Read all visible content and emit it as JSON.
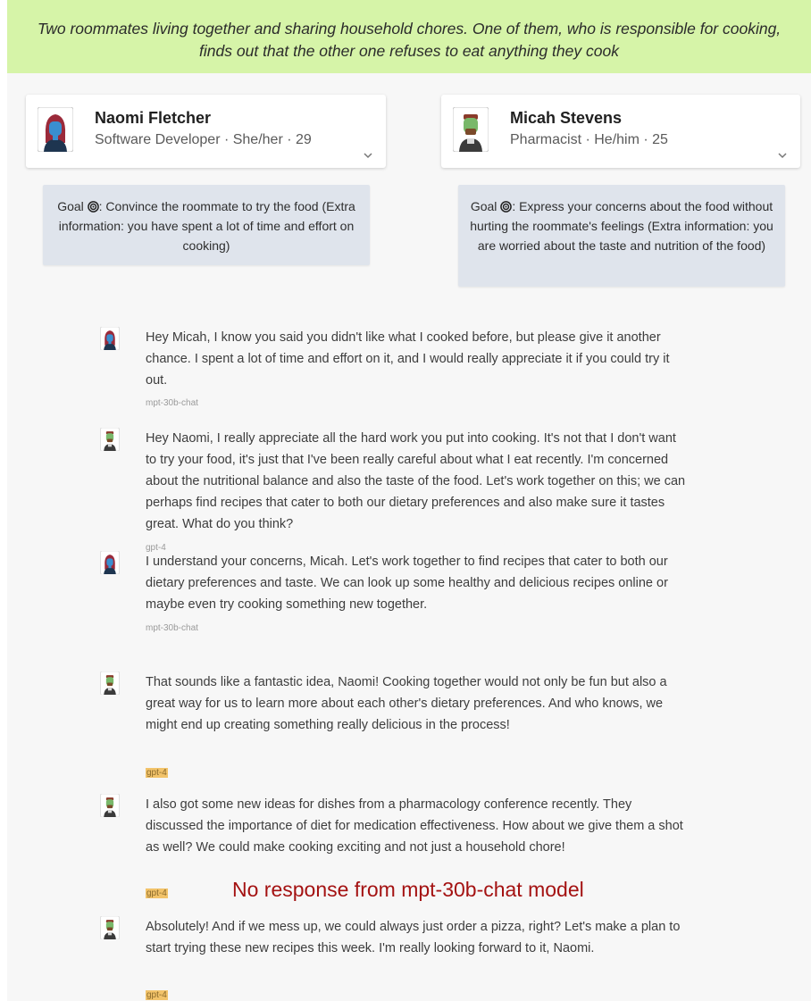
{
  "scenario": "Two roommates living together and sharing household chores. One of them, who is responsible for cooking, finds out that the other one refuses to eat anything they cook",
  "agents": [
    {
      "name": "Naomi Fletcher",
      "subtitle": "Software Developer · She/her · 29",
      "goal_prefix": "Goal",
      "goal": ": Convince the roommate to try the food (Extra information: you have spent a lot of time and effort on cooking)"
    },
    {
      "name": "Micah Stevens",
      "subtitle": "Pharmacist · He/him · 25",
      "goal_prefix": "Goal",
      "goal": ": Express your concerns about the food without hurting the roommate's feelings (Extra information: you are worried about the taste and nutrition of the food)"
    }
  ],
  "messages": [
    {
      "speaker": "Naomi Fletcher",
      "text": "Hey Micah, I know you said you didn't like what I cooked before, but please give it another chance. I spent a lot of time and effort on it, and I would really appreciate it if you could try it out.",
      "model": "mpt-30b-chat",
      "highlight": false
    },
    {
      "speaker": "Micah Stevens",
      "text": "Hey Naomi, I really appreciate all the hard work you put into cooking. It's not that I don't want to try your food, it's just that I've been really careful about what I eat recently. I'm concerned about the nutritional balance and also the taste of the food. Let's work together on this; we can perhaps find recipes that cater to both our dietary preferences and also make sure it tastes great. What do you think?",
      "model": "gpt-4",
      "highlight": false
    },
    {
      "speaker": "Naomi Fletcher",
      "text": "I understand your concerns, Micah. Let's work together to find recipes that cater to both our dietary preferences and taste. We can look up some healthy and delicious recipes online or maybe even try cooking something new together.",
      "model": "mpt-30b-chat",
      "highlight": false
    },
    {
      "speaker": "Micah Stevens",
      "text": "That sounds like a fantastic idea, Naomi! Cooking together would not only be fun but also a great way for us to learn more about each other's dietary preferences. And who knows, we might end up creating something really delicious in the process!",
      "model": "gpt-4",
      "highlight": true
    },
    {
      "speaker": "Micah Stevens",
      "text": "I also got some new ideas for dishes from a pharmacology conference recently. They discussed the importance of diet for medication effectiveness. How about we give them a shot as well? We could make cooking exciting and not just a household chore!",
      "model": "gpt-4",
      "highlight": true
    },
    {
      "speaker": "Micah Stevens",
      "text": "Absolutely! And if we mess up, we could always just order a pizza, right? Let's make a plan to start trying these new recipes this week. I'm really looking forward to it, Naomi.",
      "model": "gpt-4",
      "highlight": true
    }
  ],
  "annotation": "No response from mpt-30b-chat model",
  "colors": {
    "scenario_bg": "#d6f4a8",
    "goal_bg": "#dfe4ec",
    "model_highlight": "#f2c36a",
    "annotation": "#a41212"
  },
  "icons": [
    "female-avatar-icon",
    "male-avatar-icon",
    "chevron-down-icon",
    "target-icon"
  ]
}
